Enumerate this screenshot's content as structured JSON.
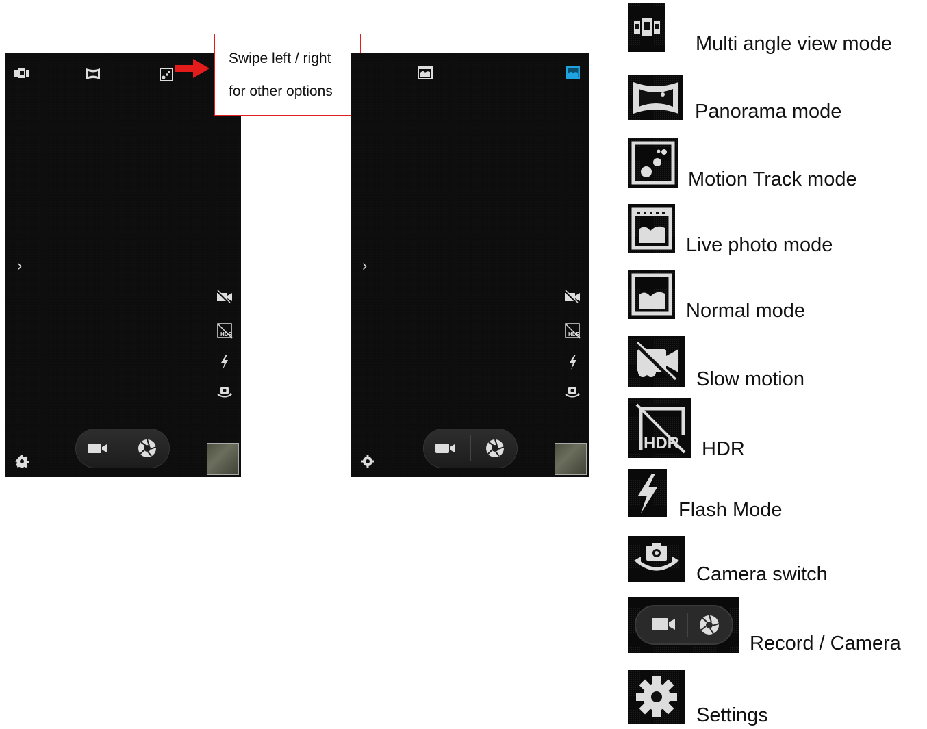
{
  "callout": {
    "line1": "Swipe left / right",
    "line2": "for other options",
    "border_color": "#e02020",
    "arrow_color": "#e41b1b"
  },
  "phone_left": {
    "top_icons": [
      "multi-angle-view-icon",
      "panorama-icon",
      "motion-track-icon"
    ],
    "side_icons": [
      "slow-motion-icon",
      "hdr-icon",
      "flash-icon",
      "camera-switch-icon"
    ],
    "expand_glyph": "›"
  },
  "phone_right": {
    "top_icons": [
      "live-photo-icon",
      "normal-mode-icon"
    ],
    "active_icon_color": "#1fa3e0",
    "side_icons": [
      "slow-motion-icon",
      "hdr-icon",
      "flash-icon",
      "camera-switch-icon"
    ],
    "expand_glyph": "›"
  },
  "legend": [
    {
      "icon": "multi-angle-view-icon",
      "label": "Multi angle view mode"
    },
    {
      "icon": "panorama-icon",
      "label": "Panorama mode"
    },
    {
      "icon": "motion-track-icon",
      "label": "Motion Track mode"
    },
    {
      "icon": "live-photo-icon",
      "label": "Live photo mode"
    },
    {
      "icon": "normal-mode-icon",
      "label": "Normal mode"
    },
    {
      "icon": "slow-motion-icon",
      "label": "Slow motion"
    },
    {
      "icon": "hdr-icon",
      "label": "HDR"
    },
    {
      "icon": "flash-icon",
      "label": "Flash Mode"
    },
    {
      "icon": "camera-switch-icon",
      "label": "Camera switch"
    },
    {
      "icon": "record-camera-icon",
      "label": "Record / Camera"
    },
    {
      "icon": "settings-icon",
      "label": "Settings"
    }
  ]
}
